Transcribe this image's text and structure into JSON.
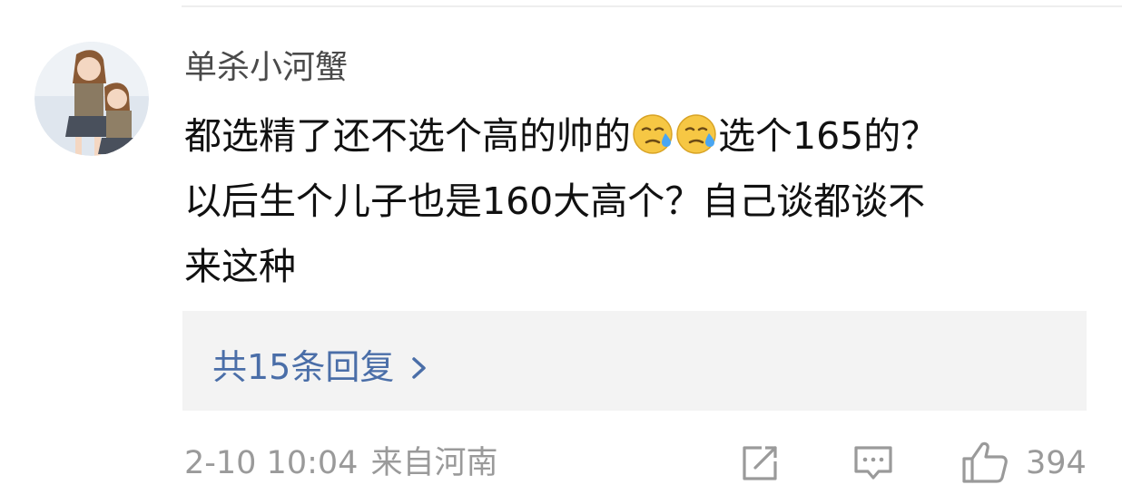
{
  "comment": {
    "username": "单杀小河蟹",
    "avatar_icon": "anime-avatar-icon",
    "text": {
      "line1_part1": "都选精了还不选个高的帅的",
      "line1_part2": "选个165的？",
      "line2": "以后生个儿子也是160大高个？自己谈都谈不",
      "line3": "来这种"
    },
    "emoji_icons": [
      "sweat-face-icon",
      "sweat-face-icon"
    ]
  },
  "replies": {
    "label": "共15条回复",
    "icon": "chevron-right-icon",
    "color": "#4a6ea8"
  },
  "meta": {
    "date": "2-10 10:04",
    "location": "来自河南"
  },
  "actions": {
    "share_icon": "share-icon",
    "comment_icon": "comment-icon",
    "like_icon": "thumbs-up-icon",
    "like_count": "394"
  },
  "colors": {
    "text": "#111111",
    "username": "#4a4a4a",
    "muted": "#9a9a9a",
    "reply_bg": "#f3f3f3"
  }
}
